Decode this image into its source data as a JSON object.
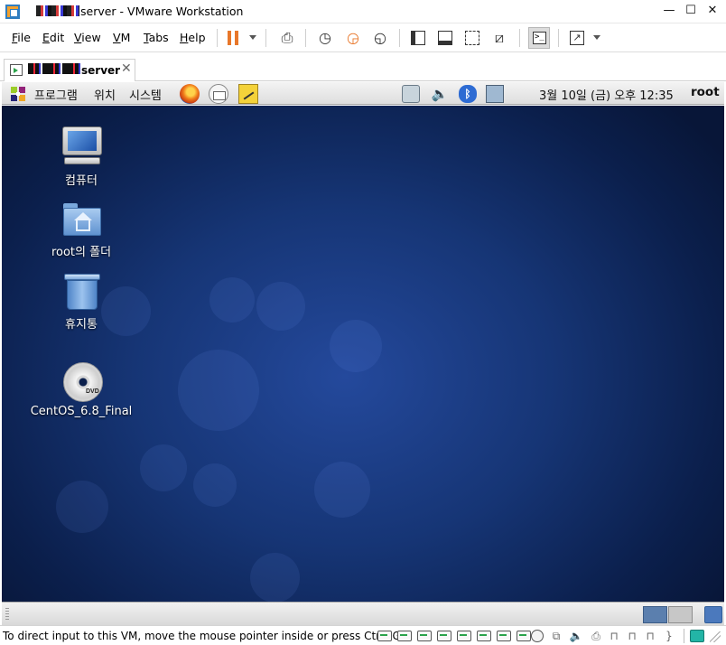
{
  "window": {
    "title_suffix": "server - VMware Workstation",
    "minimize": "—",
    "maximize": "☐",
    "close": "✕"
  },
  "menu": {
    "file": "File",
    "edit": "Edit",
    "view": "View",
    "vm": "VM",
    "tabs": "Tabs",
    "help": "Help"
  },
  "tab": {
    "label": "server",
    "close": "✕"
  },
  "guest_panel": {
    "applications": "프로그램",
    "places": "위치",
    "system": "시스템",
    "clock": "3월 10일 (금) 오후 12:35",
    "user": "root"
  },
  "desktop": {
    "icons": [
      {
        "label": "컴퓨터",
        "icon": "computer-icon"
      },
      {
        "label": "root의 폴더",
        "icon": "home-folder-icon"
      },
      {
        "label": "휴지통",
        "icon": "trash-icon"
      },
      {
        "label": "CentOS_6.8_Final",
        "icon": "dvd-icon"
      }
    ],
    "dvd_badge": "DVD"
  },
  "statusbar": {
    "message": "To direct input to this VM, move the mouse pointer inside or press Ctrl+G."
  },
  "colors": {
    "accent_pause": "#e8772a",
    "desktop_blue": "#163575",
    "workspace_active": "#5b7fae"
  }
}
